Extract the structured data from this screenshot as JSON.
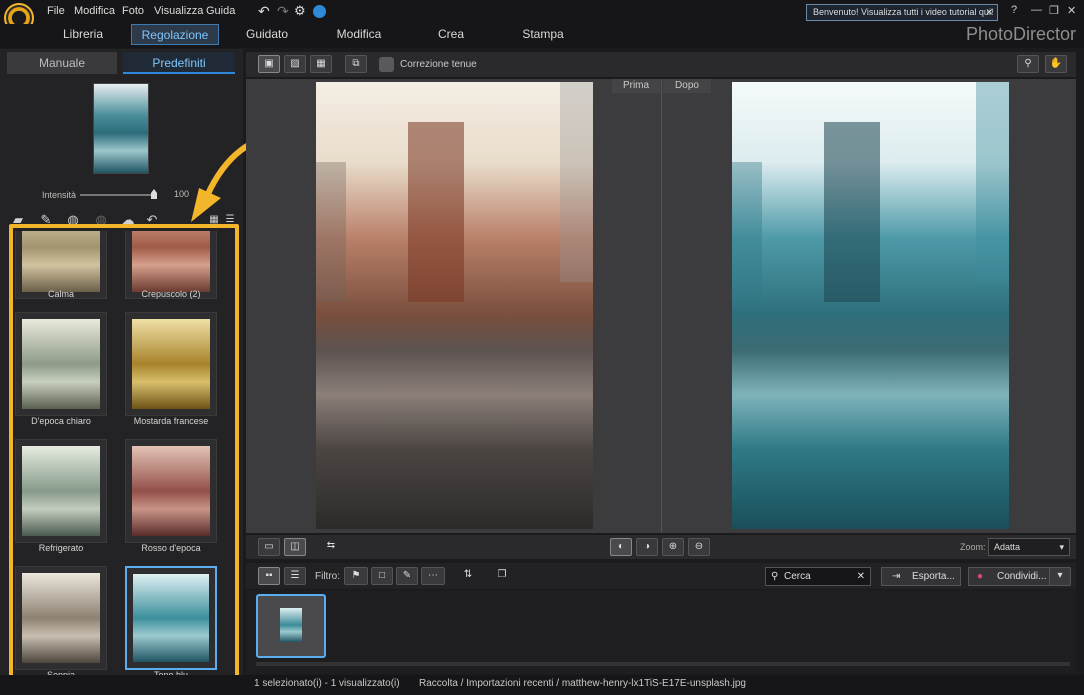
{
  "menu": [
    "File",
    "Modifica",
    "Foto",
    "Visualizza",
    "Guida"
  ],
  "welcome_banner": "Benvenuto! Visualizza tutti i video tutorial qui!",
  "tabs": [
    "Libreria",
    "Regolazione",
    "Guidato",
    "Modifica",
    "Crea",
    "Stampa"
  ],
  "active_tab": "Regolazione",
  "brand": "PhotoDirector",
  "panel_tabs": {
    "manual": "Manuale",
    "presets": "Predefiniti"
  },
  "intensity": {
    "label": "Intensità",
    "value": "100"
  },
  "presets": [
    {
      "name": "Calma",
      "tone": "#c9b48c"
    },
    {
      "name": "Crepuscolo (2)",
      "tone": "#c88a74"
    },
    {
      "name": "D'epoca chiaro",
      "tone": "#a7b79f"
    },
    {
      "name": "Mostarda francese",
      "tone": "#c2a24a"
    },
    {
      "name": "Refrigerato",
      "tone": "#9fb3a0"
    },
    {
      "name": "Rosso d'epoca",
      "tone": "#a86a5c"
    },
    {
      "name": "Seppia",
      "tone": "#a99c8a"
    },
    {
      "name": "Tono blu",
      "tone": "#3c8f9c"
    }
  ],
  "selected_preset": "Tono blu",
  "toolbar": {
    "soft_correction": "Correzione tenue"
  },
  "viewer": {
    "before": "Prima",
    "after": "Dopo"
  },
  "zoom": {
    "label": "Zoom:",
    "value": "Adatta"
  },
  "filter": {
    "label": "Filtro:"
  },
  "search": {
    "placeholder": "Cerca"
  },
  "export_label": "Esporta...",
  "share_label": "Condividi...",
  "status": {
    "selection": "1 selezionato(i) - 1 visualizzato(i)",
    "path": "Raccolta / Importazioni recenti / matthew-henry-lx1TiS-E17E-unsplash.jpg"
  },
  "colors": {
    "accent": "#2e8ad8",
    "highlight": "#f3b52a"
  }
}
